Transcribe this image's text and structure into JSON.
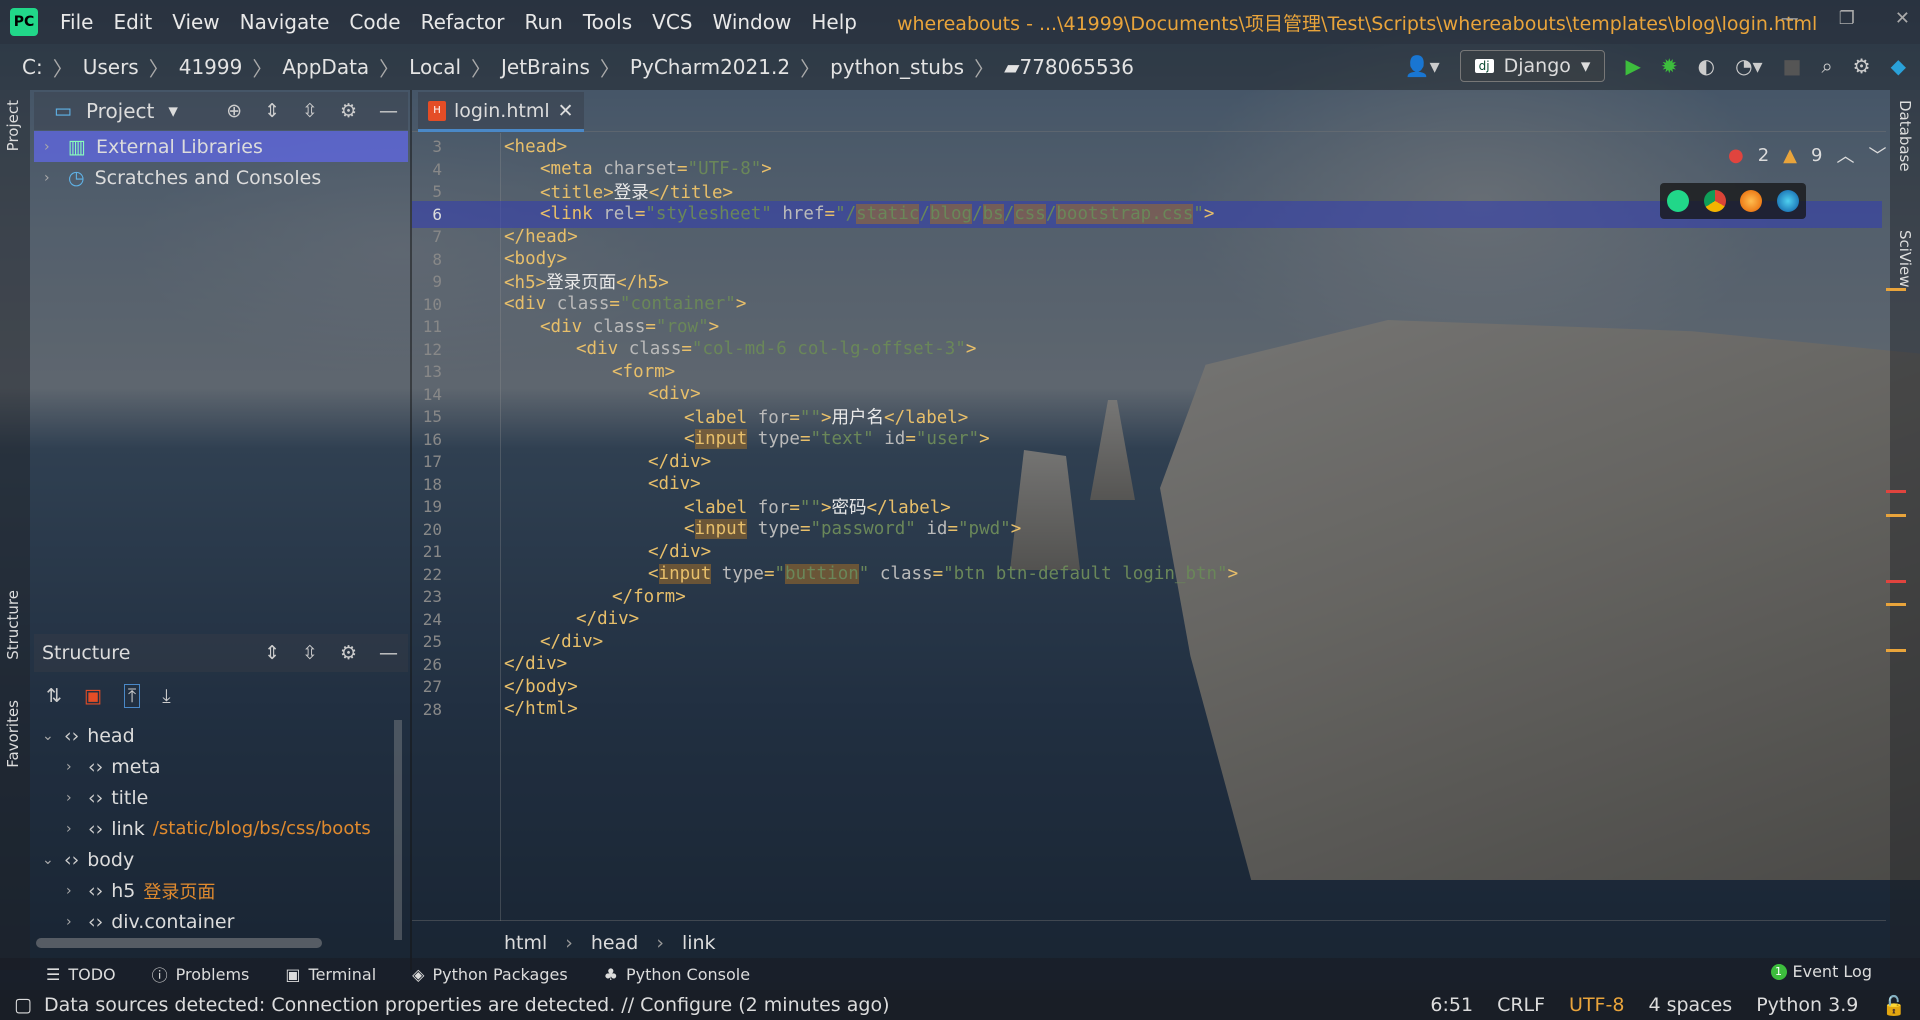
{
  "menu": [
    "File",
    "Edit",
    "View",
    "Navigate",
    "Code",
    "Refactor",
    "Run",
    "Tools",
    "VCS",
    "Window",
    "Help"
  ],
  "window_title": "whereabouts - ...\\41999\\Documents\\项目管理\\Test\\Scripts\\whereabouts\\templates\\blog\\login.html",
  "breadcrumbs": [
    "C:",
    "Users",
    "41999",
    "AppData",
    "Local",
    "JetBrains",
    "PyCharm2021.2",
    "python_stubs",
    "778065536"
  ],
  "run_config": "Django",
  "project_panel": {
    "title": "Project",
    "items": [
      "External Libraries",
      "Scratches and Consoles"
    ]
  },
  "structure_panel": {
    "title": "Structure",
    "items": [
      {
        "name": "head",
        "hint": "",
        "level": 0,
        "expanded": true
      },
      {
        "name": "meta",
        "hint": "",
        "level": 1
      },
      {
        "name": "title",
        "hint": "",
        "level": 1
      },
      {
        "name": "link",
        "hint": "/static/blog/bs/css/boots",
        "level": 1
      },
      {
        "name": "body",
        "hint": "",
        "level": 0,
        "expanded": true
      },
      {
        "name": "h5",
        "hint": "登录页面",
        "level": 1
      },
      {
        "name": "div.container",
        "hint": "",
        "level": 1
      }
    ]
  },
  "side_tabs": {
    "left": [
      "Project",
      "Structure",
      "Favorites"
    ],
    "right": [
      "Database",
      "SciView"
    ]
  },
  "editor": {
    "tab": "login.html",
    "errors": "2",
    "warnings": "9",
    "lines": [
      {
        "n": "3",
        "html": "<span class='tg'>&lt;head&gt;</span>",
        "indent": 0
      },
      {
        "n": "4",
        "html": "<span class='tg'>&lt;meta </span><span class='at'>charset</span><span class='tg'>=</span><span class='st'>\"UTF-8\"</span><span class='tg'>&gt;</span>",
        "indent": 1
      },
      {
        "n": "5",
        "html": "<span class='tg'>&lt;title&gt;</span><span class='tx'>登录</span><span class='tg'>&lt;/title&gt;</span>",
        "indent": 1
      },
      {
        "n": "6",
        "html": "<span class='tg'>&lt;link </span><span class='at'>rel</span><span class='tg'>=</span><span class='st'>\"stylesheet\"</span> <span class='at'>href</span><span class='tg'>=</span><span class='st'>\"/<span class='hl'>static</span>/<span class='hl'>blog</span>/<span class='hl'>bs</span>/<span class='hl'>css</span>/<span class='hl'>bootstrap.css</span>\"</span><span class='tg'>&gt;</span>",
        "indent": 1,
        "current": true
      },
      {
        "n": "7",
        "html": "<span class='tg'>&lt;/head&gt;</span>",
        "indent": 0
      },
      {
        "n": "8",
        "html": "<span class='tg'>&lt;body&gt;</span>",
        "indent": 0
      },
      {
        "n": "9",
        "html": "<span class='tg'>&lt;h5&gt;</span><span class='tx'>登录页面</span><span class='tg'>&lt;/h5&gt;</span>",
        "indent": 0
      },
      {
        "n": "10",
        "html": "<span class='tg'>&lt;div </span><span class='at'>class</span><span class='tg'>=</span><span class='st'>\"container\"</span><span class='tg'>&gt;</span>",
        "indent": 0
      },
      {
        "n": "11",
        "html": "<span class='tg'>&lt;div </span><span class='at'>class</span><span class='tg'>=</span><span class='st'>\"row\"</span><span class='tg'>&gt;</span>",
        "indent": 1
      },
      {
        "n": "12",
        "html": "<span class='tg'>&lt;div </span><span class='at'>class</span><span class='tg'>=</span><span class='st'>\"col-md-6 col-lg-offset-3\"</span><span class='tg'>&gt;</span>",
        "indent": 2
      },
      {
        "n": "13",
        "html": "<span class='tg'>&lt;form&gt;</span>",
        "indent": 3
      },
      {
        "n": "14",
        "html": "<span class='tg'>&lt;div&gt;</span>",
        "indent": 4
      },
      {
        "n": "15",
        "html": "<span class='tg'>&lt;label </span><span class='at'>for</span><span class='tg'>=</span><span class='st'>\"\"</span><span class='tg'>&gt;</span><span class='tx'>用户名</span><span class='tg'>&lt;/label&gt;</span>",
        "indent": 5
      },
      {
        "n": "16",
        "html": "<span class='tg'>&lt;</span><span class='tg hl'>input</span> <span class='at'>type</span><span class='tg'>=</span><span class='st'>\"text\"</span> <span class='at'>id</span><span class='tg'>=</span><span class='st'>\"user\"</span><span class='tg'>&gt;</span>",
        "indent": 5
      },
      {
        "n": "17",
        "html": "<span class='tg'>&lt;/div&gt;</span>",
        "indent": 4
      },
      {
        "n": "18",
        "html": "<span class='tg'>&lt;div&gt;</span>",
        "indent": 4
      },
      {
        "n": "19",
        "html": "<span class='tg'>&lt;label </span><span class='at'>for</span><span class='tg'>=</span><span class='st'>\"\"</span><span class='tg'>&gt;</span><span class='tx'>密码</span><span class='tg'>&lt;/label&gt;</span>",
        "indent": 5
      },
      {
        "n": "20",
        "html": "<span class='tg'>&lt;</span><span class='tg hl'>input</span> <span class='at'>type</span><span class='tg'>=</span><span class='st'>\"password\"</span> <span class='at'>id</span><span class='tg'>=</span><span class='st'>\"pwd\"</span><span class='tg'>&gt;</span>",
        "indent": 5
      },
      {
        "n": "21",
        "html": "<span class='tg'>&lt;/div&gt;</span>",
        "indent": 4
      },
      {
        "n": "22",
        "html": "<span class='tg'>&lt;</span><span class='tg hl'>input</span> <span class='at'>type</span><span class='tg'>=</span><span class='st'>\"<span class='hl'>buttion</span>\"</span> <span class='at'>class</span><span class='tg'>=</span><span class='st'>\"btn btn-default login_btn\"</span><span class='tg'>&gt;</span>",
        "indent": 4
      },
      {
        "n": "23",
        "html": "<span class='tg'>&lt;/form&gt;</span>",
        "indent": 3
      },
      {
        "n": "24",
        "html": "<span class='tg'>&lt;/div&gt;</span>",
        "indent": 2
      },
      {
        "n": "25",
        "html": "<span class='tg'>&lt;/div&gt;</span>",
        "indent": 1
      },
      {
        "n": "26",
        "html": "<span class='tg'>&lt;/div&gt;</span>",
        "indent": 0
      },
      {
        "n": "27",
        "html": "<span class='tg'>&lt;/body&gt;</span>",
        "indent": 0
      },
      {
        "n": "28",
        "html": "<span class='tg'>&lt;/html&gt;</span>",
        "indent": 0
      }
    ]
  },
  "editor_breadcrumb": [
    "html",
    "head",
    "link"
  ],
  "bottom_tools": [
    "TODO",
    "Problems",
    "Terminal",
    "Python Packages",
    "Python Console"
  ],
  "event_log": {
    "count": "1",
    "label": "Event Log"
  },
  "status": {
    "message": "Data sources detected: Connection properties are detected. // Configure (2 minutes ago)",
    "position": "6:51",
    "line_sep": "CRLF",
    "encoding": "UTF-8",
    "indent": "4 spaces",
    "interpreter": "Python 3.9"
  },
  "colors": {
    "tag": "#e8bf6a",
    "string": "#6a8759",
    "accent": "#4a88c7",
    "selection": "#6068e6",
    "encoding": "#e9a43b"
  }
}
